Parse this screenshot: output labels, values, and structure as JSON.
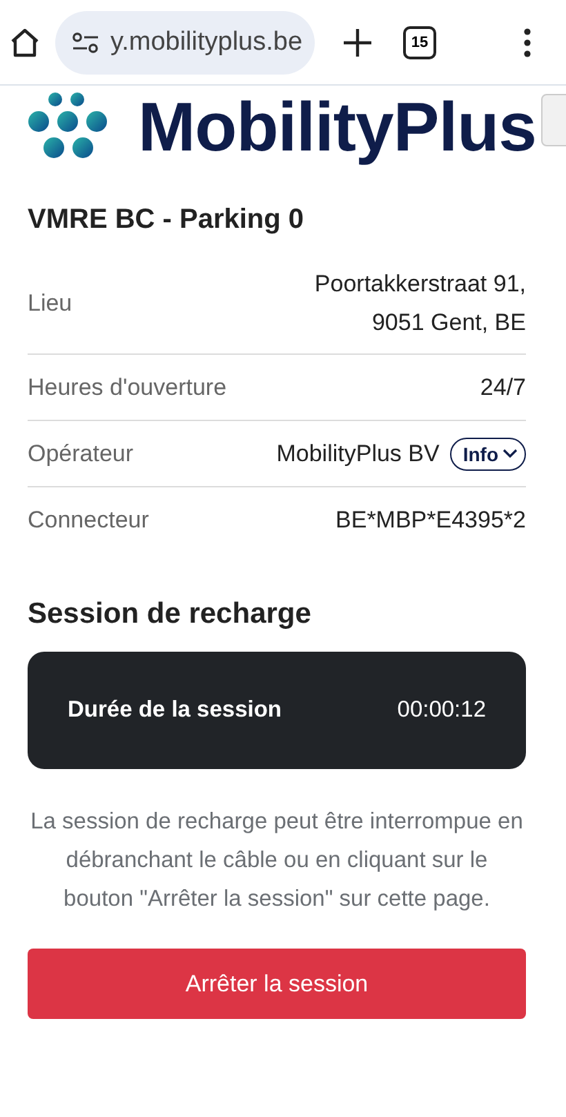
{
  "browser_bar": {
    "url": "y.mobilityplus.be",
    "tab_count": "15"
  },
  "header": {
    "logo_text": "MobilityPlus"
  },
  "station": {
    "title": "VMRE BC - Parking 0",
    "rows": [
      {
        "label": "Lieu",
        "value_lines": [
          "Poortakkerstraat 91,",
          "9051 Gent, BE"
        ]
      },
      {
        "label": "Heures d'ouverture",
        "value_lines": [
          "24/7"
        ]
      },
      {
        "label": "Opérateur",
        "value_lines": [
          "MobilityPlus BV"
        ],
        "button": "Info"
      },
      {
        "label": "Connecteur",
        "value_lines": [
          "BE*MBP*E4395*2"
        ]
      }
    ]
  },
  "session": {
    "heading": "Session de recharge",
    "duration_label": "Durée de la session",
    "duration": "00:00:12",
    "note": "La session de recharge peut être interrompue en débranchant le câble ou en cliquant sur le bouton \"Arrêter la session\" sur cette page.",
    "stop_button": "Arrêter la session"
  }
}
